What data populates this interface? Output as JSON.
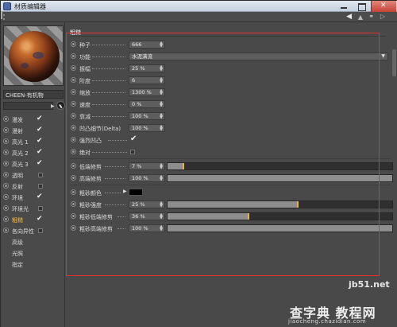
{
  "window": {
    "title": "材质编辑器"
  },
  "material": {
    "name": "CHEEN-有机物"
  },
  "channels": [
    {
      "label": "漫发",
      "checked": true,
      "selected": false
    },
    {
      "label": "漫射",
      "checked": true,
      "selected": false
    },
    {
      "label": "高光 1",
      "checked": true,
      "selected": false
    },
    {
      "label": "高光 2",
      "checked": true,
      "selected": false
    },
    {
      "label": "高光 3",
      "checked": true,
      "selected": false
    },
    {
      "label": "透明",
      "checked": false,
      "selected": false
    },
    {
      "label": "反射",
      "checked": false,
      "selected": false
    },
    {
      "label": "环境",
      "checked": true,
      "selected": false
    },
    {
      "label": "环境光",
      "checked": false,
      "selected": false
    },
    {
      "label": "粗糙",
      "checked": true,
      "selected": true
    },
    {
      "label": "各向异性",
      "checked": false,
      "selected": false
    }
  ],
  "subitems": [
    "高级",
    "光照",
    "指定"
  ],
  "section": {
    "title": "粗糙"
  },
  "params": {
    "seed": {
      "label": "种子",
      "value": "666"
    },
    "function": {
      "label": "功能",
      "value": "水泥满流"
    },
    "amplitude": {
      "label": "振幅",
      "value": "25 %"
    },
    "octaves": {
      "label": "阶度",
      "value": "6"
    },
    "scale": {
      "label": "缩放",
      "value": "1300 %"
    },
    "speed": {
      "label": "速度",
      "value": "0 %"
    },
    "attenuation": {
      "label": "衰减",
      "value": "100 %"
    },
    "bump_delta": {
      "label": "凹凸细节(Delta)",
      "value": "100 %"
    },
    "strong_bump": {
      "label": "强烈凹凸",
      "checked": true
    },
    "absolute": {
      "label": "绝对",
      "checked": false
    },
    "low_clip": {
      "label": "低端修剪",
      "value": "7 %",
      "level": 0.07
    },
    "high_clip": {
      "label": "高端修剪",
      "value": "100 %",
      "level": 1.0
    },
    "rough_color": {
      "label": "粗砂颜色",
      "color": "#000000"
    },
    "rough_strength": {
      "label": "粗砂强度",
      "value": "25 %",
      "level": 0.58
    },
    "rough_low_clip": {
      "label": "粗砂低端修剪",
      "value": "36 %",
      "level": 0.36
    },
    "rough_high_clip": {
      "label": "粗砂高端修剪",
      "value": "100 %",
      "level": 1.0
    }
  },
  "watermark": {
    "site": "jb51.net",
    "brand": "查字典 教程网",
    "url": "jiaocheng.chazidian.com"
  }
}
